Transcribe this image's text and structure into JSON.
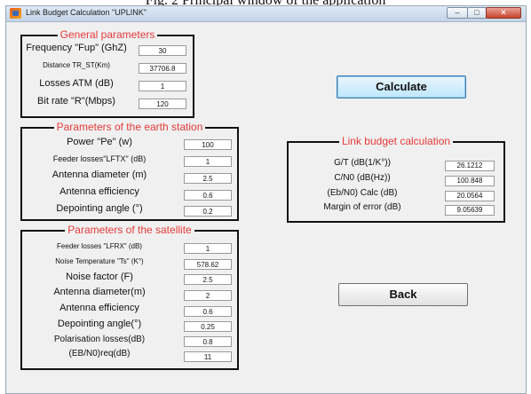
{
  "caption": "Fig. 2 Principal window of the application",
  "window": {
    "title": "Link Budget Calculation \"UPLINK\"",
    "controls": {
      "minimize": "–",
      "maximize": "□",
      "close": "✕"
    }
  },
  "general": {
    "title": "General parameters",
    "rows": [
      {
        "label": "Frequency \"Fup\" (GhZ)",
        "value": "30"
      },
      {
        "label": "Distance TR_ST(Km)",
        "value": "37706.8"
      },
      {
        "label": "Losses ATM (dB)",
        "value": "1"
      },
      {
        "label": "Bit rate \"R\"(Mbps)",
        "value": "120"
      }
    ]
  },
  "earth": {
    "title": "Parameters of the earth station",
    "rows": [
      {
        "label": "Power \"Pe\" (w)",
        "value": "100"
      },
      {
        "label": "Feeder losses\"LFTX\" (dB)",
        "value": "1"
      },
      {
        "label": "Antenna diameter (m)",
        "value": "2.5"
      },
      {
        "label": "Antenna efficiency",
        "value": "0.6"
      },
      {
        "label": "Depointing angle (°)",
        "value": "0.2"
      }
    ]
  },
  "satellite": {
    "title": "Parameters of the satellite",
    "rows": [
      {
        "label": "Feeder losses \"LFRX\" (dB)",
        "value": "1"
      },
      {
        "label": "Noise Temperature \"Ts\" (K°)",
        "value": "578.62"
      },
      {
        "label": "Noise factor (F)",
        "value": "2.5"
      },
      {
        "label": "Antenna diameter(m)",
        "value": "2"
      },
      {
        "label": "Antenna efficiency",
        "value": "0.6"
      },
      {
        "label": "Depointing angle(°)",
        "value": "0.25"
      },
      {
        "label": "Polarisation losses(dB)",
        "value": "0.8"
      },
      {
        "label": "(EB/N0)req(dB)",
        "value": "11"
      }
    ]
  },
  "results": {
    "title": "Link budget calculation",
    "rows": [
      {
        "label": "G/T  (dB(1/K°))",
        "value": "26.1212"
      },
      {
        "label": "C/N0 (dB(Hz))",
        "value": "100.848"
      },
      {
        "label": "(Eb/N0) Calc (dB)",
        "value": "20.0564"
      },
      {
        "label": "Margin of error (dB)",
        "value": "9.05639"
      }
    ]
  },
  "buttons": {
    "calculate": "Calculate",
    "back": "Back"
  }
}
